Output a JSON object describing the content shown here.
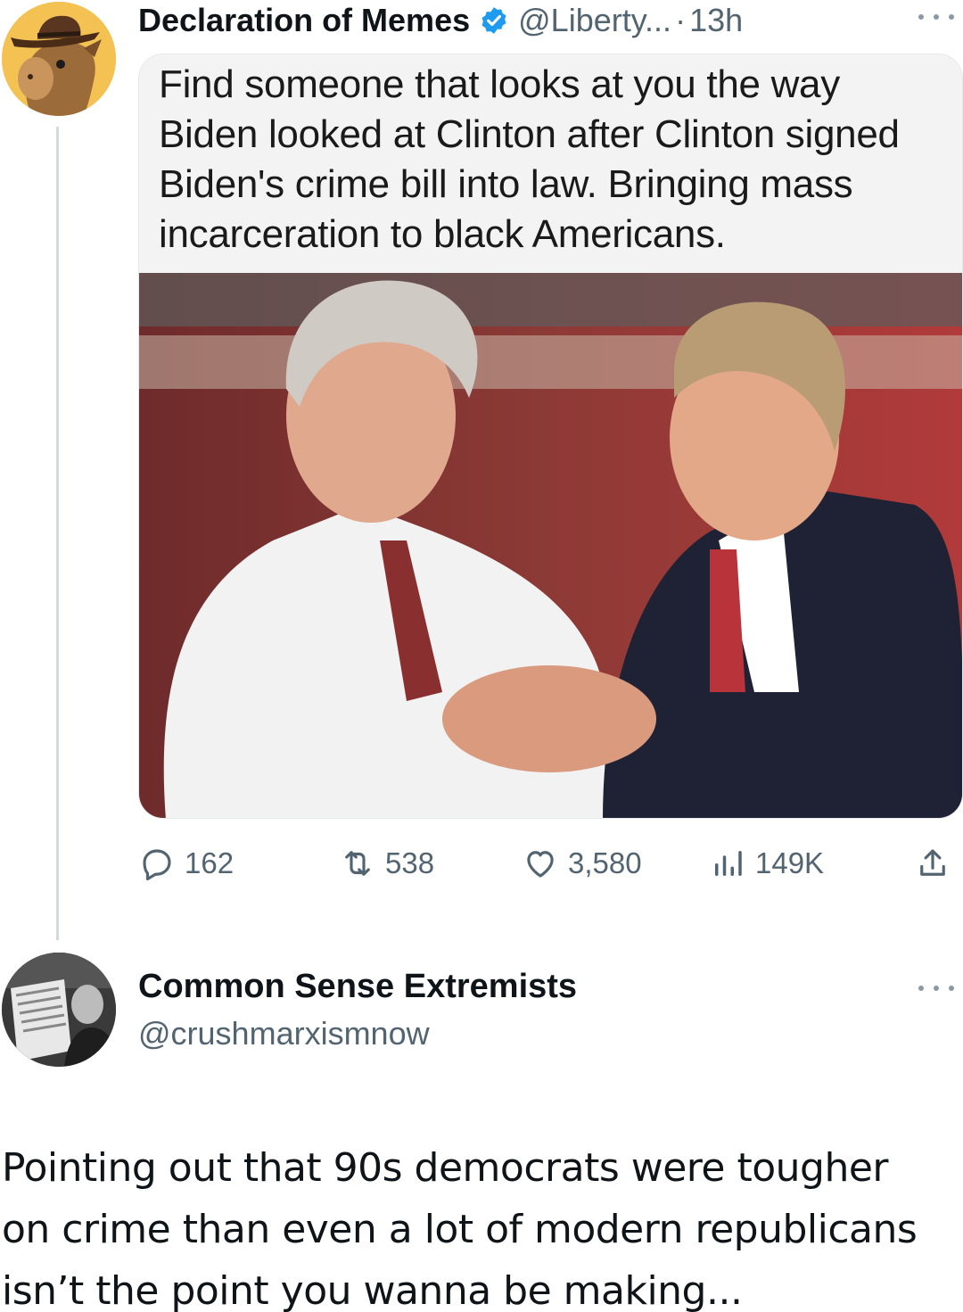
{
  "tweet": {
    "author": "Declaration of Memes",
    "handle": "@Liberty...",
    "separator": "·",
    "time": "13h",
    "meme_caption_lines": [
      "Find someone that looks at you the way",
      "Biden looked at Clinton after Clinton signed",
      "Biden's crime bill into law. Bringing mass",
      "incarceration to black Americans."
    ],
    "stats": {
      "replies": "162",
      "retweets": "538",
      "likes": "3,580",
      "views": "149K"
    }
  },
  "reply": {
    "author": "Common Sense Extremists",
    "handle": "@crushmarxismnow",
    "text_lines": [
      "Pointing out that 90s democrats were tougher",
      "on crime than even a lot of modern republicans",
      "isn’t the point you wanna be making..."
    ]
  },
  "colors": {
    "verified": "#1d9bf0",
    "muted_text": "#536471",
    "thread_line": "#cfd9de"
  },
  "icons": [
    "reply-icon",
    "retweet-icon",
    "like-icon",
    "views-icon",
    "share-icon",
    "verified-badge-icon",
    "more-icon"
  ]
}
